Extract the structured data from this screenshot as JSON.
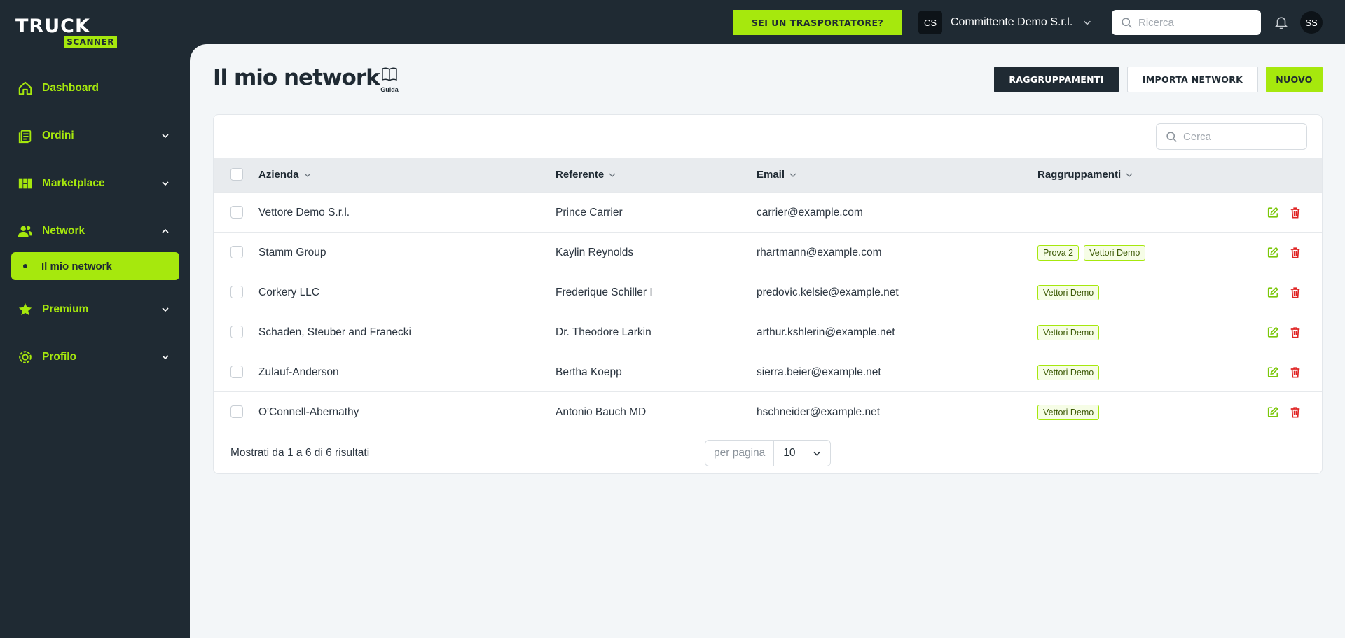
{
  "logo": {
    "top": "TRUCK",
    "bottom": "SCANNER"
  },
  "topbar": {
    "cta_label": "SEI UN TRASPORTATORE?",
    "company_initials": "CS",
    "company_name": "Committente Demo S.r.l.",
    "search_placeholder": "Ricerca",
    "user_initials": "SS"
  },
  "sidebar": {
    "items": [
      {
        "label": "Dashboard",
        "icon": "home-icon"
      },
      {
        "label": "Ordini",
        "icon": "clipboard-icon"
      },
      {
        "label": "Marketplace",
        "icon": "marketplace-icon"
      },
      {
        "label": "Network",
        "icon": "users-icon",
        "expanded": true
      },
      {
        "label": "Premium",
        "icon": "star-icon"
      },
      {
        "label": "Profilo",
        "icon": "settings-icon"
      }
    ],
    "active_subitem": "Il mio network"
  },
  "page": {
    "title": "Il mio network",
    "guide_label": "Guida",
    "buttons": {
      "groups": "RAGGRUPPAMENTI",
      "import": "IMPORTA NETWORK",
      "new": "NUOVO"
    }
  },
  "table": {
    "search_placeholder": "Cerca",
    "columns": [
      "Azienda",
      "Referente",
      "Email",
      "Raggruppamenti"
    ],
    "rows": [
      {
        "azienda": "Vettore Demo S.r.l.",
        "referente": "Prince Carrier",
        "email": "carrier@example.com",
        "tags": []
      },
      {
        "azienda": "Stamm Group",
        "referente": "Kaylin Reynolds",
        "email": "rhartmann@example.com",
        "tags": [
          "Prova 2",
          "Vettori Demo"
        ]
      },
      {
        "azienda": "Corkery LLC",
        "referente": "Frederique Schiller I",
        "email": "predovic.kelsie@example.net",
        "tags": [
          "Vettori Demo"
        ]
      },
      {
        "azienda": "Schaden, Steuber and Franecki",
        "referente": "Dr. Theodore Larkin",
        "email": "arthur.kshlerin@example.net",
        "tags": [
          "Vettori Demo"
        ]
      },
      {
        "azienda": "Zulauf-Anderson",
        "referente": "Bertha Koepp",
        "email": "sierra.beier@example.net",
        "tags": [
          "Vettori Demo"
        ]
      },
      {
        "azienda": "O'Connell-Abernathy",
        "referente": "Antonio Bauch MD",
        "email": "hschneider@example.net",
        "tags": [
          "Vettori Demo"
        ]
      }
    ],
    "footer": {
      "results_text": "Mostrati da 1 a 6 di 6 risultati",
      "per_page_label": "per pagina",
      "per_page_value": "10"
    }
  },
  "colors": {
    "accent": "#a6e80d",
    "dark": "#1f2a33",
    "background": "#f3f6f8",
    "danger": "#e02424"
  }
}
